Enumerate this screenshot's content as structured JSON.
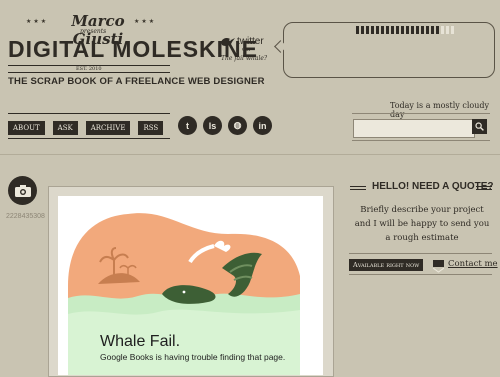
{
  "header": {
    "author": "Marco Giusti",
    "presents": "presents",
    "stars": "★★★",
    "title": "DIGITAL MOLESKINE",
    "est": "EST. 2010",
    "tagline": "THE SCRAP BOOK OF A FREELANCE WEB DESIGNER"
  },
  "twitter": {
    "label": "twitter",
    "or": "OR",
    "fail": "The fail whale?"
  },
  "nav": {
    "items": [
      "ABOUT",
      "ASK",
      "ARCHIVE",
      "RSS"
    ]
  },
  "social": {
    "icons": [
      "t",
      "ls",
      "◍",
      "in"
    ]
  },
  "weather": "Today is a mostly cloudy day",
  "search": {
    "value": ""
  },
  "post": {
    "id": "2228435308",
    "headline": "Whale Fail.",
    "subline": "Google Books is having trouble finding that page."
  },
  "quote": {
    "heading": "HELLO! NEED A QUOTE?",
    "body": "Briefly describe your project and I will be happy to send you a rough estimate",
    "availability": "Available right now",
    "contact": "Contact me"
  },
  "colors": {
    "background": "#c9c4b2",
    "ink": "#2f2b25",
    "paper": "#ece8dc",
    "whale_green": "#3d5f35",
    "orange": "#f2a97c",
    "water": "#c8ecc4"
  }
}
